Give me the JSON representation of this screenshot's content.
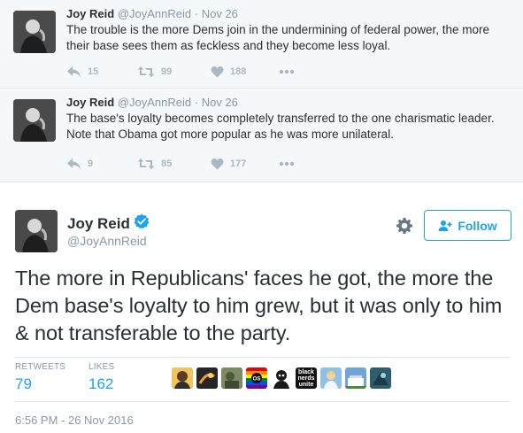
{
  "context_tweets": [
    {
      "name": "Joy Reid",
      "handle": "@JoyAnnReid",
      "separator": "·",
      "date": "Nov 26",
      "text": "The trouble is the more Dems join in the undermining of federal power, the more their base sees them as feckless and they become less loyal.",
      "replies": "15",
      "retweets": "99",
      "likes": "188"
    },
    {
      "name": "Joy Reid",
      "handle": "@JoyAnnReid",
      "separator": "·",
      "date": "Nov 26",
      "text": "The base's loyalty becomes completely transferred to the one charismatic leader. Note that Obama got more popular as he was more unilateral.",
      "replies": "9",
      "retweets": "85",
      "likes": "177"
    }
  ],
  "main_tweet": {
    "name": "Joy Reid",
    "handle": "@JoyAnnReid",
    "follow_label": "Follow",
    "text": "The more in Republicans' faces he got, the more the Dem base's loyalty to him grew, but it was only to him & not transferable to the party.",
    "retweets_label": "RETWEETS",
    "retweets_count": "79",
    "likes_label": "LIKES",
    "likes_count": "162",
    "liker_badge_text": "black nerds unite",
    "timestamp": "6:56 PM - 26 Nov 2016"
  },
  "colors": {
    "accent": "#1da1f2",
    "muted": "#8899a6",
    "icon": "#aab8c2",
    "text": "#292f33",
    "context_bg": "#f5f8fa"
  },
  "icons": [
    "reply-icon",
    "retweet-icon",
    "like-icon",
    "more-icon",
    "verified-icon",
    "gear-icon",
    "follow-user-icon"
  ]
}
